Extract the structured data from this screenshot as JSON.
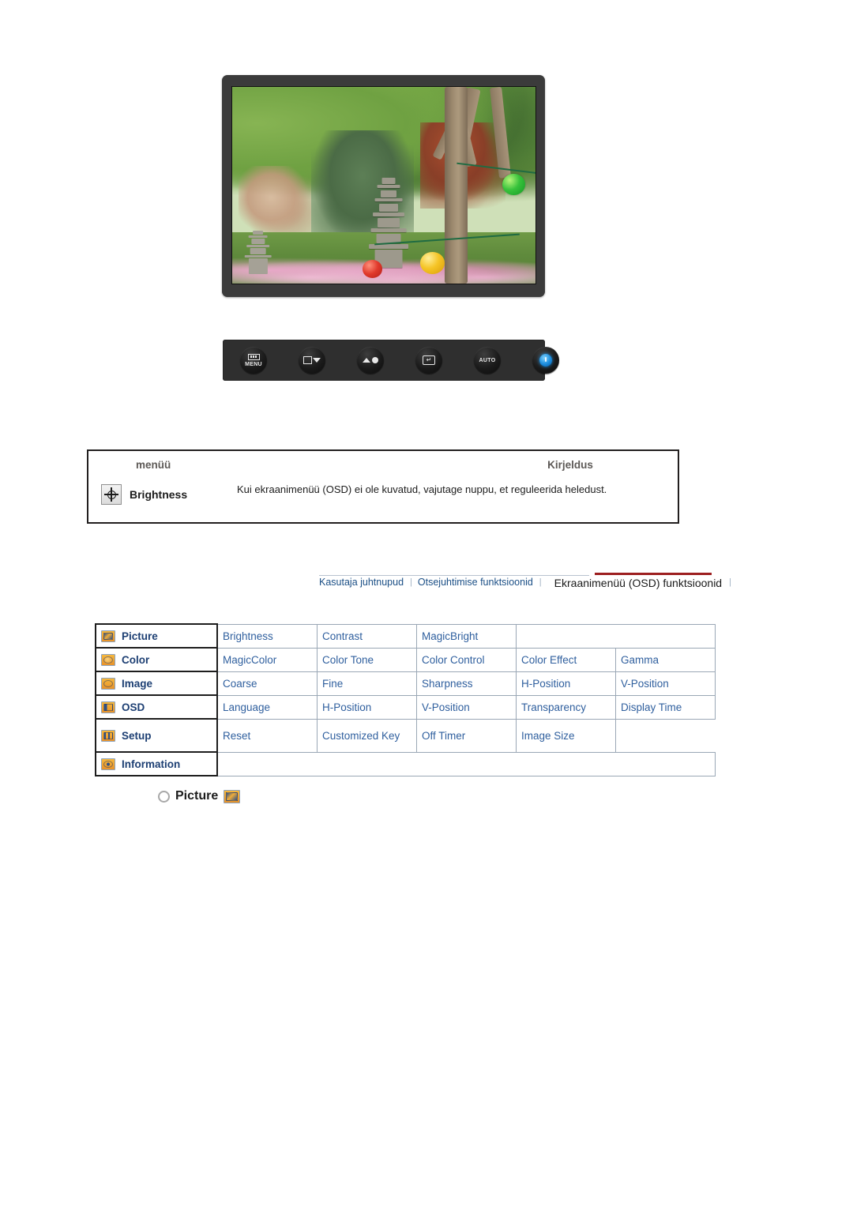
{
  "monitor": {
    "screen_photo_alt": "garden-photo-with-stone-pagoda-and-lanterns",
    "buttons": [
      {
        "name": "menu-button",
        "label": "MENU"
      },
      {
        "name": "source-down-button",
        "label": ""
      },
      {
        "name": "brightness-up-button",
        "label": ""
      },
      {
        "name": "enter-button",
        "label": ""
      },
      {
        "name": "auto-button",
        "label": "AUTO"
      },
      {
        "name": "power-button",
        "label": ""
      }
    ]
  },
  "description_table": {
    "headers": {
      "menu": "menüü",
      "description": "Kirjeldus"
    },
    "rows": [
      {
        "icon": "brightness-icon",
        "menu": "Brightness",
        "description": "Kui ekraanimenüü (OSD) ei ole kuvatud, vajutage nuppu, et reguleerida heledust."
      }
    ]
  },
  "nav": {
    "items": [
      {
        "label": "Kasutaja juhtnupud",
        "active": false
      },
      {
        "label": "Otsejuhtimise funktsioonid",
        "active": false
      },
      {
        "label": "Ekraanimenüü (OSD) funktsioonid",
        "active": true
      }
    ],
    "separator": "|",
    "active_underline_color": "#9d1f20",
    "link_color": "#1b4f86"
  },
  "menu_map": {
    "rows": [
      {
        "icon": "picture-icon",
        "label": "Picture",
        "items": [
          "Brightness",
          "Contrast",
          "MagicBright"
        ]
      },
      {
        "icon": "color-icon",
        "label": "Color",
        "items": [
          "MagicColor",
          "Color Tone",
          "Color Control",
          "Color Effect",
          "Gamma"
        ]
      },
      {
        "icon": "image-icon",
        "label": "Image",
        "items": [
          "Coarse",
          "Fine",
          "Sharpness",
          "H-Position",
          "V-Position"
        ]
      },
      {
        "icon": "osd-icon",
        "label": "OSD",
        "items": [
          "Language",
          "H-Position",
          "V-Position",
          "Transparency",
          "Display Time"
        ]
      },
      {
        "icon": "setup-icon",
        "label": "Setup",
        "items": [
          "Reset",
          "Customized Key",
          "Off Timer",
          "Image Size"
        ]
      },
      {
        "icon": "information-icon",
        "label": "Information",
        "items": []
      }
    ]
  },
  "section_heading": {
    "label": "Picture",
    "icon": "picture-icon"
  }
}
